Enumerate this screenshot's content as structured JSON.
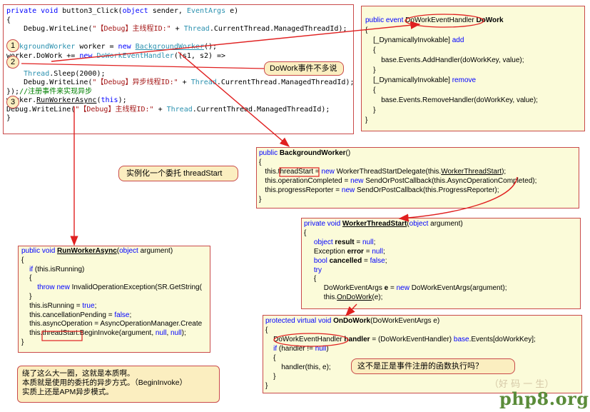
{
  "box1": {
    "lines": [
      [
        "kw:private ",
        "kw:void ",
        "t:button3_Click(",
        "kw:object ",
        "t:sender, ",
        "tp:EventArgs ",
        "t:e)"
      ],
      [
        "t:{"
      ],
      [
        "t:    Debug.WriteLine(",
        "str:\"【Debug】主线程ID:\"",
        "t: + ",
        "tp:Thread",
        "t:.CurrentThread.ManagedThreadId);"
      ],
      [
        "t: "
      ],
      [
        "tp:BackgroundWorker ",
        "t:worker = ",
        "kw:new ",
        "tpu:BackgroundWorker",
        "t:();"
      ],
      [
        "t:worker.DoWork += ",
        "kw:new ",
        "tp:DoWorkEventHandler",
        "t:((s1, s2) =>"
      ],
      [
        "t:{"
      ],
      [
        "t:    ",
        "tp:Thread",
        "t:.Sleep(2000);"
      ],
      [
        "t:    Debug.WriteLine(",
        "str:\"【Debug】异步线程ID:\"",
        "t: + ",
        "tp:Thread",
        "t:.CurrentThread.ManagedThreadId);"
      ],
      [
        "t:});",
        "cmt://注册事件来实现异步"
      ],
      [
        "t:worker.",
        "u:RunWorkerAsync",
        "t:(",
        "kw:this",
        "t:);"
      ],
      [
        "t:Debug.WriteLine(",
        "str:\"【Debug】主线程ID:\"",
        "t: + ",
        "tp:Thread",
        "t:.CurrentThread.ManagedThreadId);"
      ],
      [
        "t:}"
      ]
    ]
  },
  "box2": {
    "lines": [
      [
        "kw:public ",
        "kw:event ",
        "t:DoWorkEventHandler ",
        "b:DoWork"
      ],
      [
        "t:{"
      ],
      [
        "t:    [_DynamicallyInvokable] ",
        "kw:add"
      ],
      [
        "t:    {"
      ],
      [
        "t:        base.Events.AddHandler(doWorkKey, value);"
      ],
      [
        "t:    }"
      ],
      [
        "t:    [_DynamicallyInvokable] ",
        "kw:remove"
      ],
      [
        "t:    {"
      ],
      [
        "t:        base.Events.RemoveHandler(doWorkKey, value);"
      ],
      [
        "t:    }"
      ],
      [
        "t:}"
      ]
    ]
  },
  "box3": {
    "lines": [
      [
        "kw:public ",
        "b:BackgroundWorker",
        "t:()"
      ],
      [
        "t:{"
      ],
      [
        "t:   this.threadStart = ",
        "kw:new ",
        "t:WorkerThreadStartDelegate(this.",
        "u:WorkerThreadStart",
        "t:);"
      ],
      [
        "t:   this.operationCompleted = ",
        "kw:new ",
        "t:SendOrPostCallback(this.AsyncOperationCompleted);"
      ],
      [
        "t:   this.progressReporter = ",
        "kw:new ",
        "t:SendOrPostCallback(this.ProgressReporter);"
      ],
      [
        "t:}"
      ]
    ]
  },
  "box4": {
    "lines": [
      [
        "kw:private ",
        "kw:void ",
        "bu:WorkerThreadStart",
        "t:(",
        "kw:object ",
        "t:argument)"
      ],
      [
        "t:{"
      ],
      [
        "t:     ",
        "kw:object ",
        "b:result",
        "t: = ",
        "kw:null",
        "t:;"
      ],
      [
        "t:     Exception ",
        "b:error",
        "t: = ",
        "kw:null",
        "t:;"
      ],
      [
        "t:     ",
        "kw:bool ",
        "b:cancelled",
        "t: = ",
        "kw:false",
        "t:;"
      ],
      [
        "t:     ",
        "kw:try"
      ],
      [
        "t:     {"
      ],
      [
        "t:          DoWorkEventArgs ",
        "b:e",
        "t: = ",
        "kw:new ",
        "t:DoWorkEventArgs(argument);"
      ],
      [
        "t:          this.",
        "u:OnDoWork",
        "t:(e);"
      ]
    ]
  },
  "box5": {
    "lines": [
      [
        "kw:public ",
        "kw:void ",
        "bu:RunWorkerAsync",
        "t:(",
        "kw:object ",
        "t:argument)"
      ],
      [
        "t:{"
      ],
      [
        "t:    ",
        "kw:if ",
        "t:(this.isRunning)"
      ],
      [
        "t:    {"
      ],
      [
        "t:        ",
        "kw:throw ",
        "kw:new ",
        "t:InvalidOperationException(SR.GetString("
      ],
      [
        "t:    }"
      ],
      [
        "t:    this.isRunning = ",
        "kw:true",
        "t:;"
      ],
      [
        "t:    this.cancellationPending = ",
        "kw:false",
        "t:;"
      ],
      [
        "t:    this.asyncOperation = AsyncOperationManager.Create"
      ],
      [
        "t:    this.threadStart.BeginInvoke(argument, ",
        "kw:null",
        "t:, ",
        "kw:null",
        "t:);"
      ],
      [
        "t:}"
      ]
    ]
  },
  "box6": {
    "lines": [
      [
        "kw:protected ",
        "kw:virtual ",
        "kw:void ",
        "b:OnDoWork",
        "t:(DoWorkEventArgs e)"
      ],
      [
        "t:{"
      ],
      [
        "t:    DoWorkEventHandler ",
        "b:handler",
        "t: = (DoWorkEventHandler) ",
        "kw:base",
        "t:.Events[doWorkKey];"
      ],
      [
        "t:    ",
        "kw:if ",
        "t:(handler != ",
        "kw:null",
        "t:)"
      ],
      [
        "t:    {"
      ],
      [
        "t:        handler(this, e);"
      ],
      [
        "t:    }"
      ],
      [
        "t:}"
      ]
    ]
  },
  "numbers": [
    "1",
    "2",
    "3"
  ],
  "bubbles": {
    "dowork": "DoWork事件不多说",
    "threadstart": "实例化一个委托 threadStart",
    "handler": "这不是正是事件注册的函数执行吗？"
  },
  "note": {
    "lines": [
      "绕了这么大一圈，这就是本质啊。",
      "本质就是使用的委托的异步方式。（BeginInvoke）",
      "实质上还是APM异步模式。"
    ]
  },
  "watermark": {
    "site": "php8.org",
    "cn": "（好 码 一 生）"
  },
  "colors": {
    "keyword": "#0000ff",
    "type": "#2b91af",
    "string": "#a31515",
    "comment": "#008000",
    "arrow": "#e02020",
    "note_bg": "#fbeec0",
    "code_bg": "#fbfbd9"
  }
}
